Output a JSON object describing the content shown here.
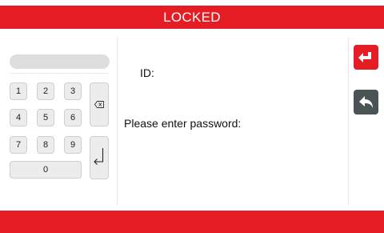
{
  "header": {
    "title": "LOCKED",
    "accent_color": "#e51c23"
  },
  "keypad": {
    "password_value": "",
    "digits": [
      "1",
      "2",
      "3",
      "4",
      "5",
      "6",
      "7",
      "8",
      "9",
      "0"
    ],
    "backspace_icon": "backspace-icon",
    "enter_icon": "enter-icon"
  },
  "form": {
    "id_label": "ID:",
    "password_prompt": "Please enter password:"
  },
  "sidebar": {
    "confirm_icon": "enter-icon",
    "confirm_color": "#e51c23",
    "back_icon": "back-arrow-icon",
    "back_color": "#4a5455"
  }
}
